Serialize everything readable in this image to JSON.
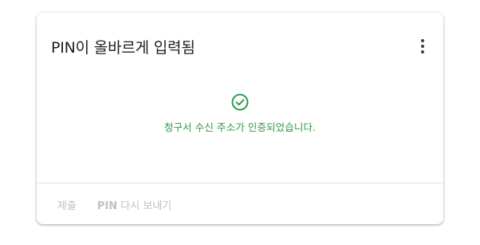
{
  "card": {
    "title": "PIN이 올바르게 입력됨",
    "menu_icon": "more-vert-icon"
  },
  "status": {
    "icon": "check-circle-icon",
    "message": "청구서 수신 주소가 인증되었습니다.",
    "color": "#2e9a45"
  },
  "actions": {
    "submit_label": "제출",
    "resend_label_prefix": "PIN",
    "resend_label_suffix": " 다시 보내기",
    "disabled_color": "#bdc1c6"
  }
}
